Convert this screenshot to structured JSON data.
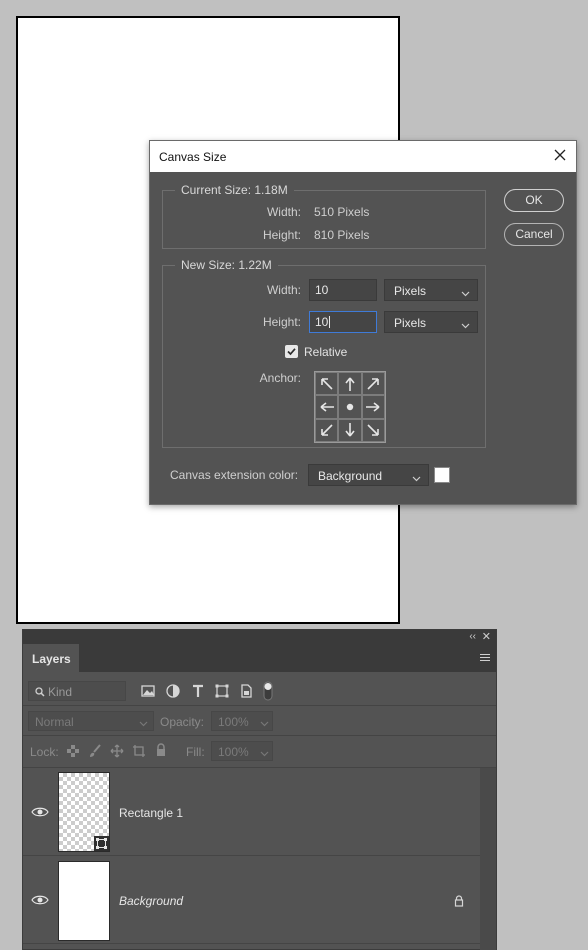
{
  "dialog": {
    "title": "Canvas Size",
    "current": {
      "legend": "Current Size: 1.18M",
      "width_label": "Width:",
      "width_value": "510 Pixels",
      "height_label": "Height:",
      "height_value": "810 Pixels"
    },
    "new": {
      "legend": "New Size: 1.22M",
      "width_label": "Width:",
      "width_value": "10",
      "width_unit": "Pixels",
      "height_label": "Height:",
      "height_value": "10",
      "height_unit": "Pixels",
      "relative_label": "Relative",
      "relative_checked": true,
      "anchor_label": "Anchor:"
    },
    "extension_label": "Canvas extension color:",
    "extension_value": "Background",
    "extension_swatch_color": "#ffffff",
    "ok_label": "OK",
    "cancel_label": "Cancel"
  },
  "layers_panel": {
    "tab_label": "Layers",
    "kind_placeholder": "Kind",
    "blend_mode": "Normal",
    "opacity_label": "Opacity:",
    "opacity_value": "100%",
    "lock_label": "Lock:",
    "fill_label": "Fill:",
    "fill_value": "100%",
    "layers": [
      {
        "name": "Rectangle 1",
        "italic": false,
        "locked": false
      },
      {
        "name": "Background",
        "italic": true,
        "locked": true
      }
    ]
  },
  "colors": {
    "app_background": "#c0c0c0",
    "panel": "#535353",
    "focus_accent": "#3f7bd8"
  }
}
